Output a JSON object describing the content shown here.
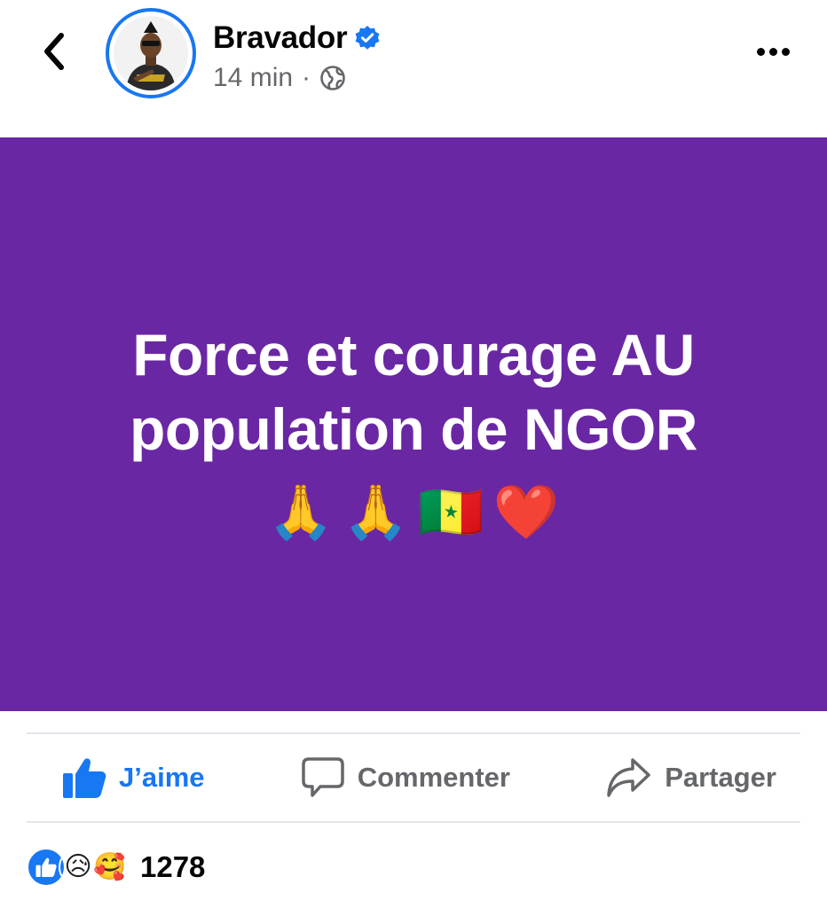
{
  "header": {
    "author_name": "Bravador",
    "verified": true,
    "timestamp": "14 min",
    "separator": "·",
    "audience_icon": "globe-icon",
    "back_icon": "chevron-left-icon",
    "more_icon": "more-horizontal-icon"
  },
  "post": {
    "background_color": "#6a27a3",
    "text": "Force et courage AU population de NGOR",
    "emojis": [
      "🙏",
      "🙏",
      "🇸🇳",
      "❤️"
    ]
  },
  "actions": {
    "like_label": "J’aime",
    "comment_label": "Commenter",
    "share_label": "Partager",
    "like_color": "#1877f2"
  },
  "reactions": {
    "icons": [
      "like-icon",
      "sad-icon",
      "care-icon"
    ],
    "care_glyph": "🥰",
    "sad_glyph": "😥",
    "count": "1278"
  }
}
